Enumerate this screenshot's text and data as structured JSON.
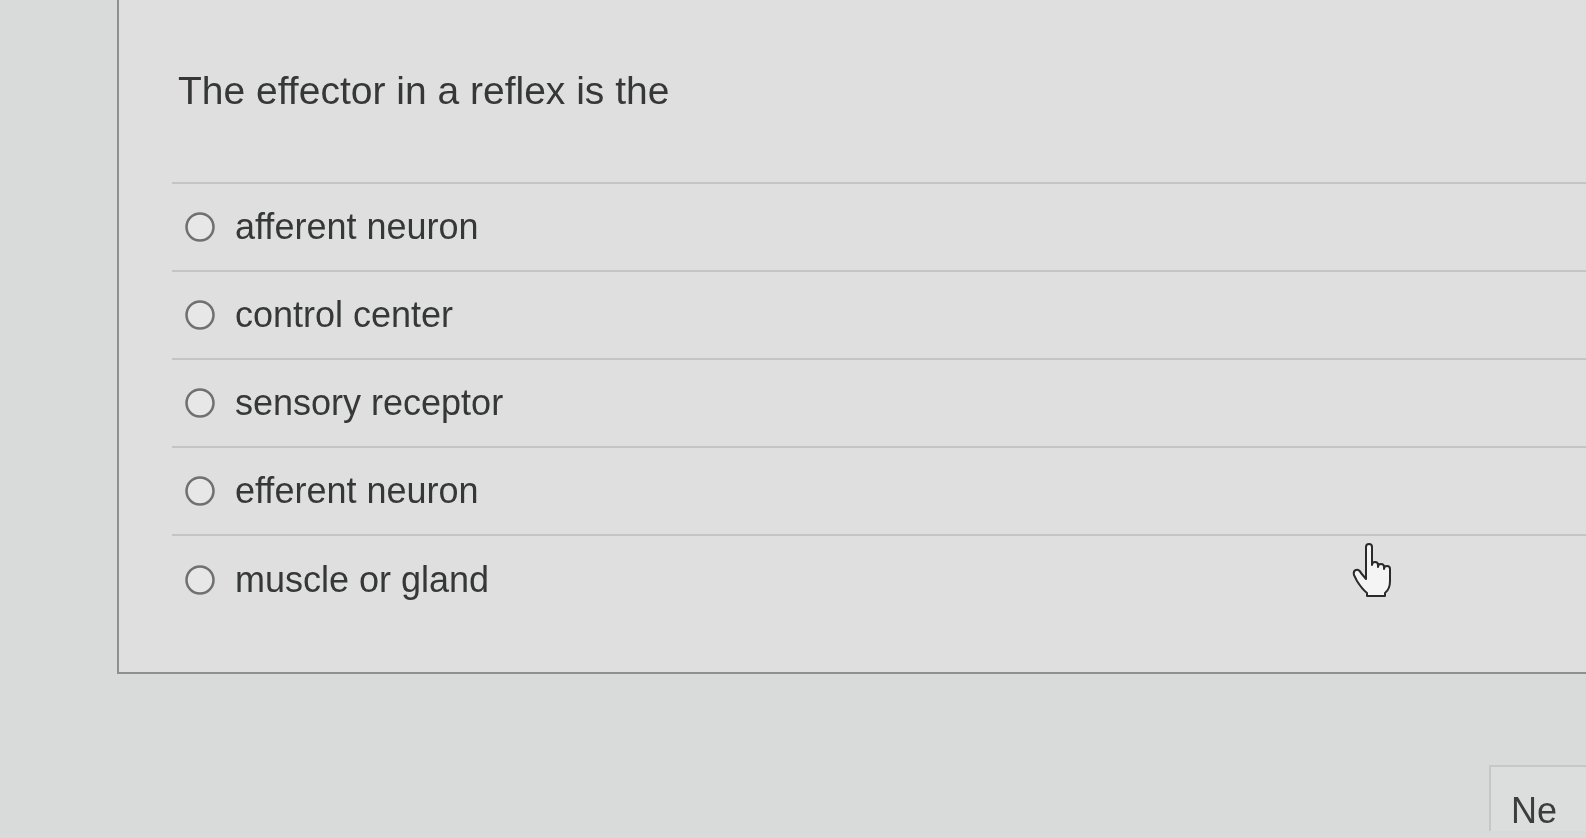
{
  "question": {
    "text": "The effector in a reflex is the"
  },
  "options": [
    {
      "label": "afferent neuron",
      "selected": false
    },
    {
      "label": "control center",
      "selected": false
    },
    {
      "label": "sensory receptor",
      "selected": false
    },
    {
      "label": "efferent neuron",
      "selected": false
    },
    {
      "label": "muscle or gland",
      "selected": false
    }
  ],
  "next_button": {
    "label": "Ne"
  }
}
